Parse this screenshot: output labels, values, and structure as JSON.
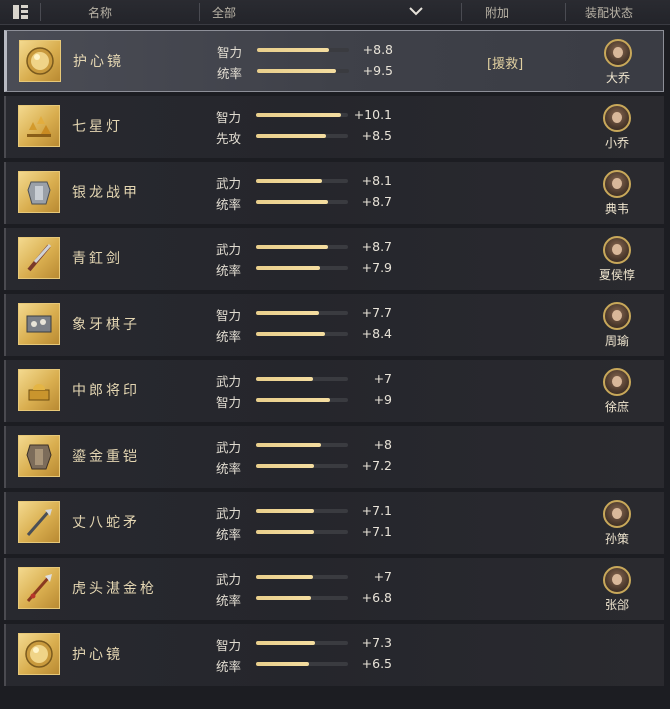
{
  "header": {
    "name_col": "名称",
    "filter_col": "全部",
    "extra_col": "附加",
    "status_col": "装配状态"
  },
  "items": [
    {
      "name": "护心镜",
      "icon": "mirror-icon",
      "stats": [
        {
          "label": "智力",
          "value": "+8.8",
          "level": 0.78
        },
        {
          "label": "统率",
          "value": "+9.5",
          "level": 0.86
        }
      ],
      "extra": "[援救]",
      "hero": "大乔"
    },
    {
      "name": "七星灯",
      "icon": "lamps-icon",
      "stats": [
        {
          "label": "智力",
          "value": "+10.1",
          "level": 0.92
        },
        {
          "label": "先攻",
          "value": "+8.5",
          "level": 0.76
        }
      ],
      "extra": "",
      "hero": "小乔"
    },
    {
      "name": "银龙战甲",
      "icon": "armor-icon",
      "stats": [
        {
          "label": "武力",
          "value": "+8.1",
          "level": 0.72
        },
        {
          "label": "统率",
          "value": "+8.7",
          "level": 0.78
        }
      ],
      "extra": "",
      "hero": "典韦"
    },
    {
      "name": "青釭剑",
      "icon": "sword-icon",
      "stats": [
        {
          "label": "武力",
          "value": "+8.7",
          "level": 0.78
        },
        {
          "label": "统率",
          "value": "+7.9",
          "level": 0.7
        }
      ],
      "extra": "",
      "hero": "夏侯惇"
    },
    {
      "name": "象牙棋子",
      "icon": "chess-icon",
      "stats": [
        {
          "label": "智力",
          "value": "+7.7",
          "level": 0.68
        },
        {
          "label": "统率",
          "value": "+8.4",
          "level": 0.75
        }
      ],
      "extra": "",
      "hero": "周瑜"
    },
    {
      "name": "中郎将印",
      "icon": "seal-icon",
      "stats": [
        {
          "label": "武力",
          "value": "+7",
          "level": 0.62
        },
        {
          "label": "智力",
          "value": "+9",
          "level": 0.8
        }
      ],
      "extra": "",
      "hero": "徐庶"
    },
    {
      "name": "鎏金重铠",
      "icon": "heavy-armor-icon",
      "stats": [
        {
          "label": "武力",
          "value": "+8",
          "level": 0.71
        },
        {
          "label": "统率",
          "value": "+7.2",
          "level": 0.63
        }
      ],
      "extra": "",
      "hero": ""
    },
    {
      "name": "丈八蛇矛",
      "icon": "spear-icon",
      "stats": [
        {
          "label": "武力",
          "value": "+7.1",
          "level": 0.63
        },
        {
          "label": "统率",
          "value": "+7.1",
          "level": 0.63
        }
      ],
      "extra": "",
      "hero": "孙策"
    },
    {
      "name": "虎头湛金枪",
      "icon": "lance-icon",
      "stats": [
        {
          "label": "武力",
          "value": "+7",
          "level": 0.62
        },
        {
          "label": "统率",
          "value": "+6.8",
          "level": 0.6
        }
      ],
      "extra": "",
      "hero": "张郃"
    },
    {
      "name": "护心镜",
      "icon": "mirror-icon",
      "stats": [
        {
          "label": "智力",
          "value": "+7.3",
          "level": 0.64
        },
        {
          "label": "统率",
          "value": "+6.5",
          "level": 0.58
        }
      ],
      "extra": "",
      "hero": ""
    }
  ]
}
